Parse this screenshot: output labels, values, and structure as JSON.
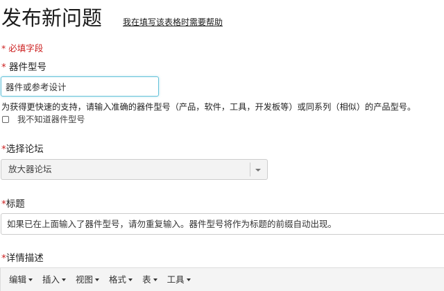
{
  "header": {
    "title": "发布新问题",
    "help_link": "我在填写该表格时需要帮助"
  },
  "form": {
    "required_note": "* 必填字段",
    "part_number": {
      "star": "* ",
      "label": "器件型号",
      "value": "器件或参考设计",
      "help": "为获得更快速的支持，请输入准确的器件型号（产品，软件，工具，开发板等）或同系列（相似）的产品型号。",
      "unknown_checkbox_label": "我不知道器件型号"
    },
    "forum": {
      "star": "*",
      "label": "选择论坛",
      "selected": "放大器论坛"
    },
    "title_field": {
      "star": "*",
      "label": "标题",
      "placeholder": "如果已在上面输入了器件型号，请勿重复输入。器件型号将作为标题的前缀自动出现。"
    },
    "details": {
      "star": "*",
      "label": "详情描述"
    }
  },
  "editor": {
    "menus": [
      "编辑",
      "插入",
      "视图",
      "格式",
      "表",
      "工具"
    ]
  },
  "colors": {
    "required": "#cc1f1f",
    "focus_border": "#66c2d9"
  }
}
